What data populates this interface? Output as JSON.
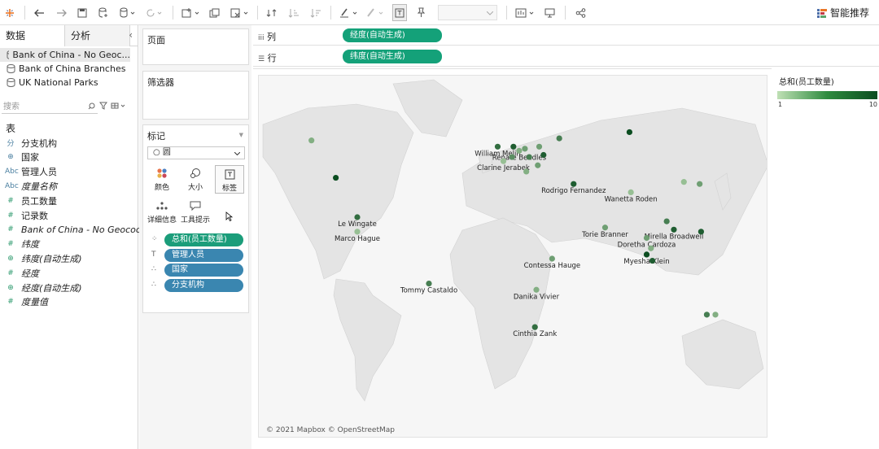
{
  "toolbar": {
    "smart_label": "智能推荐",
    "icons": [
      "tableau-logo-icon",
      "undo-icon",
      "redo-icon",
      "save-icon",
      "new-datasource-icon",
      "datasource-icon",
      "refresh-icon",
      "new-sheet-icon",
      "duplicate-icon",
      "clear-icon",
      "swap-icon",
      "sort-asc-icon",
      "sort-desc-icon",
      "highlight-icon",
      "group-icon",
      "label-icon",
      "pin-icon",
      "fit-dropdown",
      "show-cards-icon",
      "presentation-icon",
      "share-icon"
    ]
  },
  "left_panel": {
    "tab_data": "数据",
    "tab_analysis": "分析",
    "datasources": [
      "Bank of China - No Geoc...",
      "Bank of China Branches",
      "UK National Parks"
    ],
    "search_placeholder": "搜索",
    "table_header": "表",
    "fields": [
      {
        "icon": "分",
        "name": "分支机构",
        "italic": false
      },
      {
        "icon": "⊕",
        "name": "国家",
        "italic": false
      },
      {
        "icon": "Abc",
        "name": "管理人员",
        "italic": false
      },
      {
        "icon": "Abc",
        "name": "度量名称",
        "italic": true
      },
      {
        "icon": "#",
        "name": "员工数量",
        "italic": false
      },
      {
        "icon": "#",
        "name": "记录数",
        "italic": false
      },
      {
        "icon": "#",
        "name": "Bank of China - No Geocodi...",
        "italic": true
      },
      {
        "icon": "#",
        "name": "纬度",
        "italic": true
      },
      {
        "icon": "⊕",
        "name": "纬度(自动生成)",
        "italic": true
      },
      {
        "icon": "#",
        "name": "经度",
        "italic": true
      },
      {
        "icon": "⊕",
        "name": "经度(自动生成)",
        "italic": true
      },
      {
        "icon": "#",
        "name": "度量值",
        "italic": true
      }
    ]
  },
  "cards": {
    "pages": "页面",
    "filters": "筛选器",
    "marks": "标记",
    "mark_type": "○ 圆",
    "buttons": [
      "颜色",
      "大小",
      "标签",
      "详细信息",
      "工具提示"
    ],
    "pills": [
      {
        "label": "总和(员工数量)",
        "kind": "g",
        "icon": "color"
      },
      {
        "label": "管理人员",
        "kind": "b",
        "icon": "label"
      },
      {
        "label": "国家",
        "kind": "b",
        "icon": "detail"
      },
      {
        "label": "分支机构",
        "kind": "b",
        "icon": "detail"
      }
    ]
  },
  "shelves": {
    "columns_label": "列",
    "columns_pill": "经度(自动生成)",
    "rows_label": "行",
    "rows_pill": "纬度(自动生成)"
  },
  "legend": {
    "title": "总和(员工数量)",
    "min": "1",
    "max": "10",
    "colors": [
      "#bfe0b5",
      "#0b4d20"
    ]
  },
  "map": {
    "attribution": "© 2021 Mapbox © OpenStreetMap",
    "points": [
      {
        "name": "William Melin",
        "lon": -2,
        "lat": 54,
        "v": 8
      },
      {
        "name": "Renate Beadles",
        "lon": 13,
        "lat": 52,
        "v": 4
      },
      {
        "name": "Clarine Jerabek",
        "lon": 2,
        "lat": 47,
        "v": 3
      },
      {
        "name": "Rodrigo Fernandez",
        "lon": 51,
        "lat": 36,
        "v": 9
      },
      {
        "name": "Wanetta Roden",
        "lon": 91,
        "lat": 32,
        "v": 3
      },
      {
        "name": "Torie Branner",
        "lon": 73,
        "lat": 15,
        "v": 5
      },
      {
        "name": "Mirella Broadwell",
        "lon": 121,
        "lat": 14,
        "v": 9
      },
      {
        "name": "Doretha Cardoza",
        "lon": 102,
        "lat": 10,
        "v": 5
      },
      {
        "name": "Myesha Klein",
        "lon": 102,
        "lat": 2,
        "v": 10
      },
      {
        "name": "Le Wingate",
        "lon": -100,
        "lat": 20,
        "v": 8
      },
      {
        "name": "Marco Hague",
        "lon": -100,
        "lat": 13,
        "v": 3
      },
      {
        "name": "Contessa Hauge",
        "lon": 36,
        "lat": 0,
        "v": 5
      },
      {
        "name": "Tommy Castaldo",
        "lon": -50,
        "lat": -12,
        "v": 7
      },
      {
        "name": "Danika Vivier",
        "lon": 25,
        "lat": -15,
        "v": 4
      },
      {
        "name": "Cinthia Zank",
        "lon": 24,
        "lat": -33,
        "v": 8
      },
      {
        "name": "",
        "lon": 9,
        "lat": 54,
        "v": 9
      },
      {
        "name": "",
        "lon": 17,
        "lat": 53,
        "v": 5
      },
      {
        "name": "",
        "lon": 8,
        "lat": 49,
        "v": 6
      },
      {
        "name": "",
        "lon": 20,
        "lat": 49,
        "v": 7
      },
      {
        "name": "",
        "lon": 26,
        "lat": 45,
        "v": 5
      },
      {
        "name": "",
        "lon": 18,
        "lat": 42,
        "v": 4
      },
      {
        "name": "",
        "lon": 30,
        "lat": 50,
        "v": 9
      },
      {
        "name": "",
        "lon": 41,
        "lat": 58,
        "v": 7
      },
      {
        "name": "",
        "lon": 27,
        "lat": 54,
        "v": 5
      },
      {
        "name": "",
        "lon": 90,
        "lat": 61,
        "v": 10
      },
      {
        "name": "",
        "lon": -132,
        "lat": 57,
        "v": 4
      },
      {
        "name": "",
        "lon": -115,
        "lat": 39,
        "v": 10
      },
      {
        "name": "",
        "lon": 139,
        "lat": 36,
        "v": 5
      },
      {
        "name": "",
        "lon": 128,
        "lat": 37,
        "v": 3
      },
      {
        "name": "",
        "lon": 116,
        "lat": 18,
        "v": 7
      },
      {
        "name": "",
        "lon": 140,
        "lat": 13,
        "v": 9
      },
      {
        "name": "",
        "lon": 105,
        "lat": 5,
        "v": 4
      },
      {
        "name": "",
        "lon": 106,
        "lat": -1,
        "v": 9
      },
      {
        "name": "",
        "lon": 150,
        "lat": -27,
        "v": 4
      },
      {
        "name": "",
        "lon": 144,
        "lat": -27,
        "v": 7
      }
    ]
  }
}
